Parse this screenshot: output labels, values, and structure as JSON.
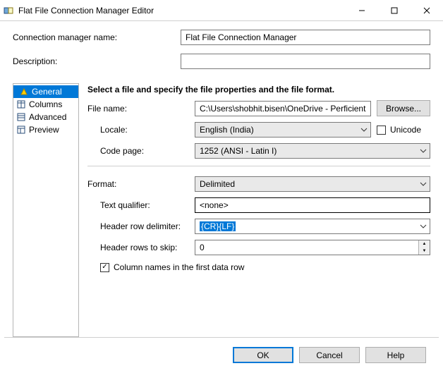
{
  "window": {
    "title": "Flat File Connection Manager Editor"
  },
  "labels": {
    "conn_name": "Connection manager name:",
    "description": "Description:"
  },
  "values": {
    "conn_name": "Flat File Connection Manager",
    "description": ""
  },
  "sidebar": {
    "items": [
      {
        "label": "General",
        "selected": true
      },
      {
        "label": "Columns",
        "selected": false
      },
      {
        "label": "Advanced",
        "selected": false
      },
      {
        "label": "Preview",
        "selected": false
      }
    ]
  },
  "main": {
    "instruction": "Select a file and specify the file properties and the file format.",
    "file_name_label": "File name:",
    "file_name": "C:\\Users\\shobhit.bisen\\OneDrive - Perficient,",
    "browse": "Browse...",
    "locale_label": "Locale:",
    "locale": "English (India)",
    "unicode_label": "Unicode",
    "unicode_checked": false,
    "codepage_label": "Code page:",
    "codepage": "1252  (ANSI - Latin I)",
    "format_label": "Format:",
    "format": "Delimited",
    "textq_label": "Text qualifier:",
    "textq": "<none>",
    "hrow_delim_label": "Header row delimiter:",
    "hrow_delim": "{CR}{LF}",
    "hrow_skip_label": "Header rows to skip:",
    "hrow_skip": "0",
    "colnames_label": "Column names in the first data row",
    "colnames_checked": true
  },
  "footer": {
    "ok": "OK",
    "cancel": "Cancel",
    "help": "Help"
  }
}
